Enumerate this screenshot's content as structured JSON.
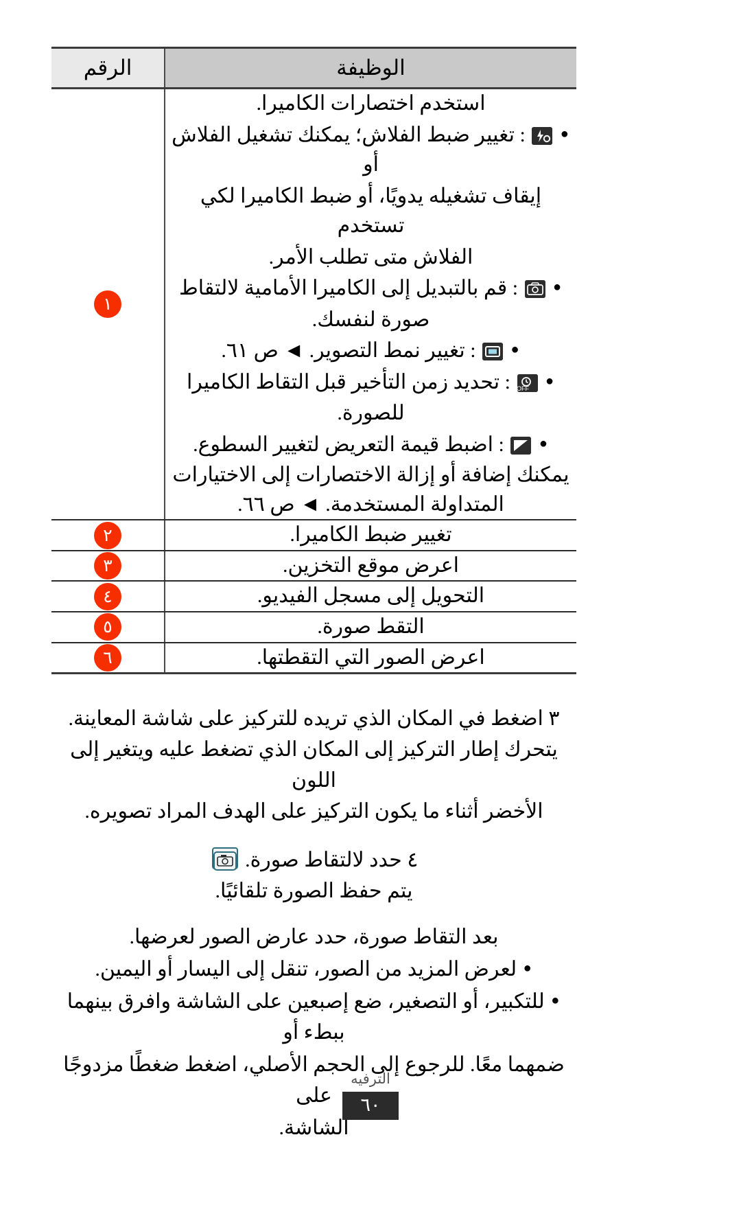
{
  "table": {
    "headers": {
      "function": "الوظيفة",
      "number": "الرقم"
    },
    "rows": [
      {
        "number": "١",
        "intro": "استخدم اختصارات الكاميرا.",
        "bullets": [
          {
            "icon": "flash-icon",
            "lines": [
              ": تغيير ضبط الفلاش؛ يمكنك تشغيل الفلاش أو",
              "إيقاف تشغيله يدويًا، أو ضبط الكاميرا لكي تستخدم",
              "الفلاش متى تطلب الأمر."
            ]
          },
          {
            "icon": "switch-camera-icon",
            "lines": [
              ": قم بالتبديل إلى الكاميرا الأمامية لالتقاط",
              "صورة لنفسك."
            ]
          },
          {
            "icon": "shooting-mode-icon",
            "lines": [
              ": تغيير نمط التصوير. ◄ ص ٦١."
            ]
          },
          {
            "icon": "timer-icon",
            "lines": [
              ": تحديد زمن التأخير قبل التقاط الكاميرا",
              "للصورة."
            ]
          },
          {
            "icon": "exposure-icon",
            "lines": [
              ": اضبط قيمة التعريض لتغيير السطوع."
            ]
          }
        ],
        "outro": [
          "يمكنك إضافة أو إزالة الاختصارات إلى الاختيارات",
          "المتداولة المستخدمة. ◄ ص ٦٦."
        ]
      },
      {
        "number": "٢",
        "text": "تغيير ضبط الكاميرا."
      },
      {
        "number": "٣",
        "text": "اعرض موقع التخزين."
      },
      {
        "number": "٤",
        "text": "التحويل إلى مسجل الفيديو."
      },
      {
        "number": "٥",
        "text": "التقط صورة."
      },
      {
        "number": "٦",
        "text": "اعرض الصور التي التقطتها."
      }
    ]
  },
  "steps": [
    {
      "number": "٣",
      "lines": [
        "اضغط في المكان الذي تريده للتركيز على شاشة المعاينة.",
        "يتحرك إطار التركيز إلى المكان الذي تضغط عليه ويتغير إلى اللون",
        "الأخضر أثناء ما يكون التركيز على الهدف المراد تصويره."
      ]
    },
    {
      "number": "٤",
      "icon": "shutter-icon",
      "lines": [
        "حدد  لالتقاط صورة.",
        "يتم حفظ الصورة تلقائيًا."
      ]
    }
  ],
  "after_capture": {
    "intro": "بعد التقاط صورة، حدد عارض الصور لعرضها.",
    "bullets": [
      {
        "lines": [
          "لعرض المزيد من الصور، تنقل إلى اليسار أو اليمين."
        ]
      },
      {
        "lines": [
          "للتكبير، أو التصغير، ضع إصبعين على الشاشة وافرق بينهما ببطء أو",
          "ضمهما معًا. للرجوع إلى الحجم الأصلي، اضغط ضغطًا مزدوجًا على",
          "الشاشة."
        ]
      }
    ]
  },
  "footer": {
    "label": "الترفيه",
    "page": "٦٠"
  },
  "colors": {
    "badge": "#f72e00",
    "header_fn_bg": "#c9c9c9",
    "header_num_bg": "#e9e9e9",
    "rule": "#2b2b2b"
  }
}
